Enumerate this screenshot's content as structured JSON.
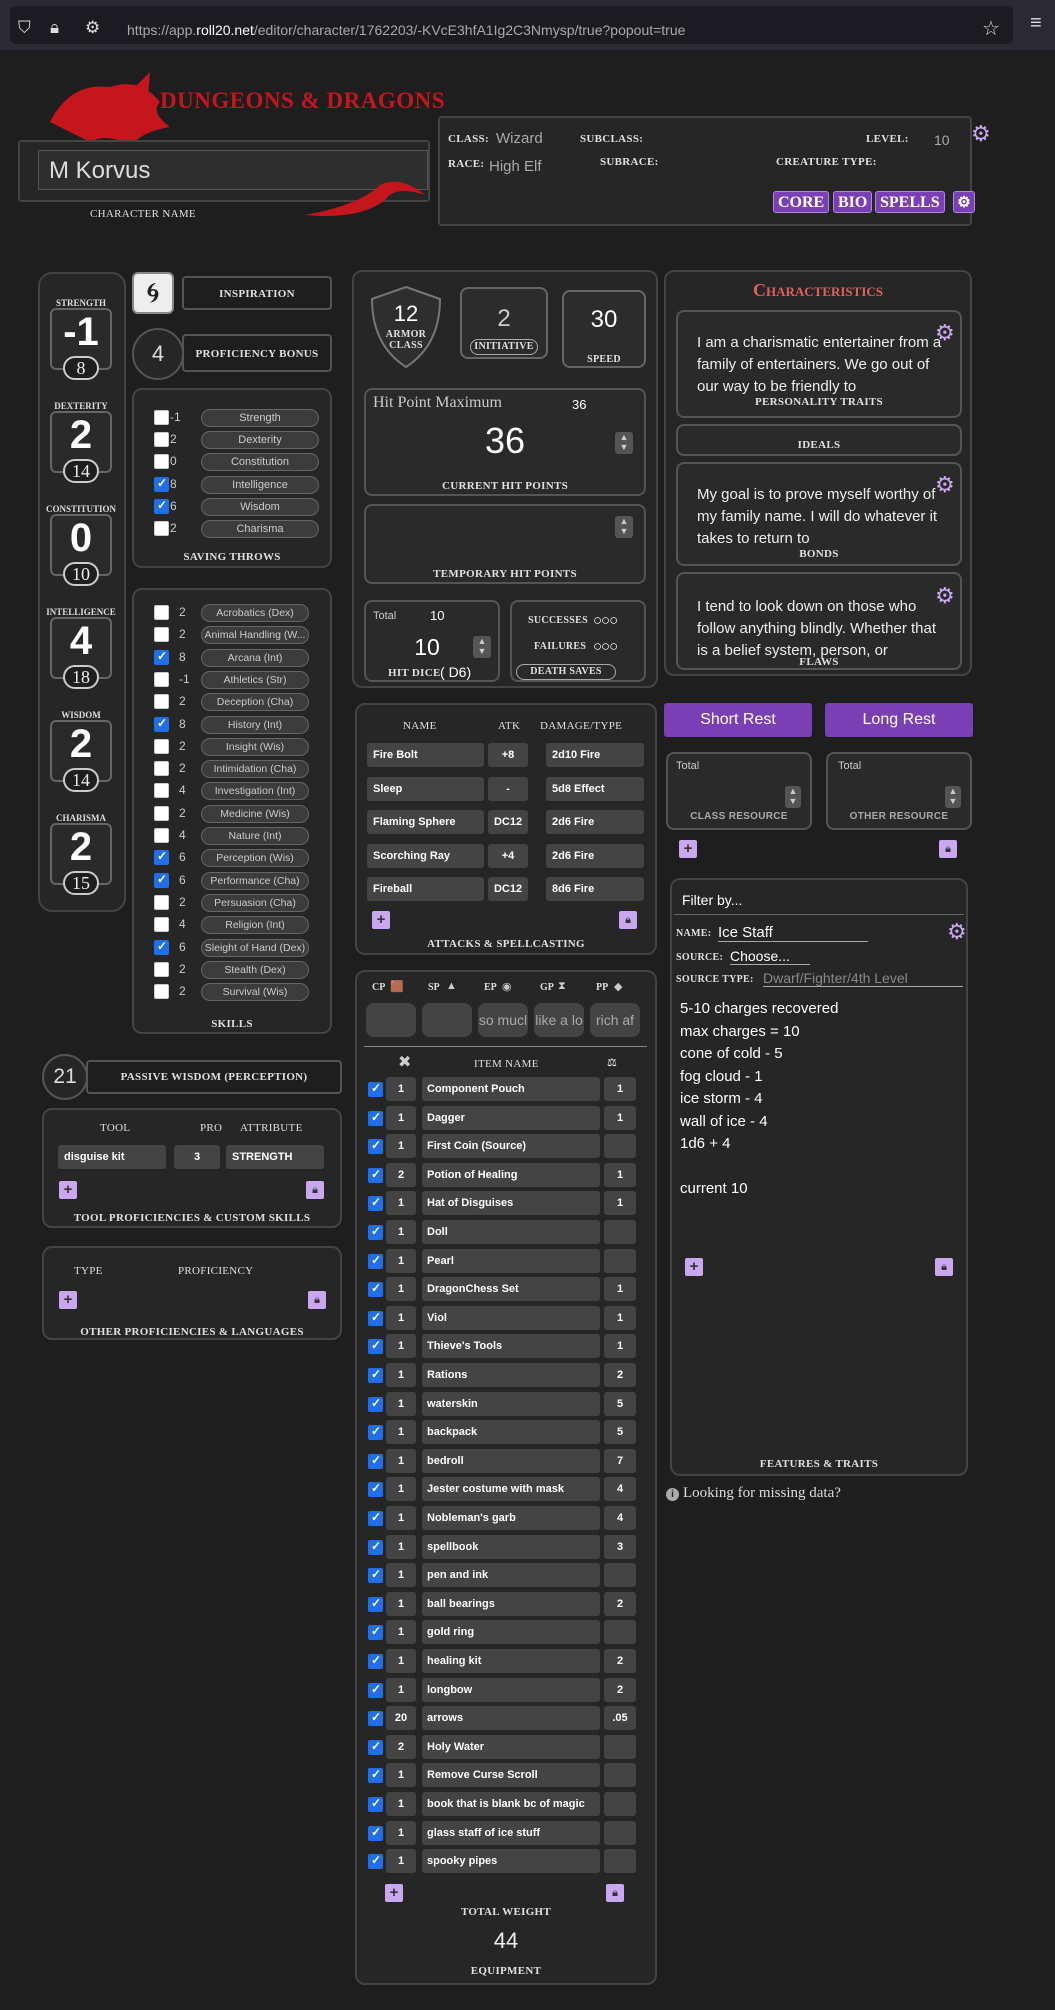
{
  "browser": {
    "url_prefix": "https://app.",
    "url_domain": "roll20.net",
    "url_path": "/editor/character/1762203/-KVcE3hfA1Ig2C3Nmysp/true?popout=true"
  },
  "header": {
    "logo_text": "DUNGEONS & DRAGONS",
    "character_name": "M Korvus",
    "character_name_label": "CHARACTER NAME",
    "class_label": "CLASS:",
    "class_value": "Wizard",
    "subclass_label": "SUBCLASS:",
    "level_label": "LEVEL:",
    "level_value": "10",
    "race_label": "RACE:",
    "race_value": "High Elf",
    "subrace_label": "SUBRACE:",
    "creature_type_label": "CREATURE TYPE:"
  },
  "tabs": [
    "CORE",
    "BIO",
    "SPELLS"
  ],
  "abilities": [
    {
      "name": "STRENGTH",
      "mod": "-1",
      "score": "8"
    },
    {
      "name": "DEXTERITY",
      "mod": "2",
      "score": "14"
    },
    {
      "name": "CONSTITUTION",
      "mod": "0",
      "score": "10"
    },
    {
      "name": "INTELLIGENCE",
      "mod": "4",
      "score": "18"
    },
    {
      "name": "WISDOM",
      "mod": "2",
      "score": "14"
    },
    {
      "name": "CHARISMA",
      "mod": "2",
      "score": "15"
    }
  ],
  "inspiration_label": "INSPIRATION",
  "proficiency": {
    "value": "4",
    "label": "PROFICIENCY BONUS"
  },
  "saving_throws": {
    "label": "SAVING THROWS",
    "items": [
      {
        "checked": false,
        "value": "-1",
        "name": "Strength"
      },
      {
        "checked": false,
        "value": "2",
        "name": "Dexterity"
      },
      {
        "checked": false,
        "value": "0",
        "name": "Constitution"
      },
      {
        "checked": true,
        "value": "8",
        "name": "Intelligence"
      },
      {
        "checked": true,
        "value": "6",
        "name": "Wisdom"
      },
      {
        "checked": false,
        "value": "2",
        "name": "Charisma"
      }
    ]
  },
  "skills": {
    "label": "SKILLS",
    "items": [
      {
        "checked": false,
        "value": "2",
        "name": "Acrobatics (Dex)"
      },
      {
        "checked": false,
        "value": "2",
        "name": "Animal Handling (W..."
      },
      {
        "checked": true,
        "value": "8",
        "name": "Arcana (Int)"
      },
      {
        "checked": false,
        "value": "-1",
        "name": "Athletics (Str)"
      },
      {
        "checked": false,
        "value": "2",
        "name": "Deception (Cha)"
      },
      {
        "checked": true,
        "value": "8",
        "name": "History (Int)"
      },
      {
        "checked": false,
        "value": "2",
        "name": "Insight (Wis)"
      },
      {
        "checked": false,
        "value": "2",
        "name": "Intimidation (Cha)"
      },
      {
        "checked": false,
        "value": "4",
        "name": "Investigation (Int)"
      },
      {
        "checked": false,
        "value": "2",
        "name": "Medicine (Wis)"
      },
      {
        "checked": false,
        "value": "4",
        "name": "Nature (Int)"
      },
      {
        "checked": true,
        "value": "6",
        "name": "Perception (Wis)"
      },
      {
        "checked": true,
        "value": "6",
        "name": "Performance (Cha)"
      },
      {
        "checked": false,
        "value": "2",
        "name": "Persuasion (Cha)"
      },
      {
        "checked": false,
        "value": "4",
        "name": "Religion (Int)"
      },
      {
        "checked": true,
        "value": "6",
        "name": "Sleight of Hand (Dex)"
      },
      {
        "checked": false,
        "value": "2",
        "name": "Stealth (Dex)"
      },
      {
        "checked": false,
        "value": "2",
        "name": "Survival (Wis)"
      }
    ]
  },
  "passive": {
    "value": "21",
    "label": "PASSIVE WISDOM (PERCEPTION)"
  },
  "tools": {
    "headers": [
      "TOOL",
      "PRO",
      "ATTRIBUTE"
    ],
    "row": {
      "tool": "disguise kit",
      "pro": "3",
      "attribute": "STRENGTH"
    },
    "label": "TOOL PROFICIENCIES & CUSTOM SKILLS"
  },
  "other_prof": {
    "headers": [
      "TYPE",
      "PROFICIENCY"
    ],
    "label": "OTHER PROFICIENCIES & LANGUAGES"
  },
  "combat": {
    "ac": "12",
    "ac_label": "ARMOR CLASS",
    "initiative": "2",
    "initiative_label": "INITIATIVE",
    "speed": "30",
    "speed_label": "SPEED",
    "hp_max_label": "Hit Point Maximum",
    "hp_max": "36",
    "hp_current": "36",
    "hp_current_label": "CURRENT HIT POINTS",
    "temp_label": "TEMPORARY HIT POINTS",
    "hd_total_label": "Total",
    "hd_total": "10",
    "hd_value": "10",
    "hd_label": "HIT DICE",
    "hd_die": "D6",
    "successes_label": "SUCCESSES",
    "failures_label": "FAILURES",
    "death_label": "DEATH SAVES"
  },
  "attacks": {
    "headers": [
      "NAME",
      "ATK",
      "DAMAGE/TYPE"
    ],
    "rows": [
      {
        "name": "Fire Bolt",
        "atk": "+8",
        "dmg": "2d10 Fire"
      },
      {
        "name": "Sleep",
        "atk": "-",
        "dmg": "5d8 Effect"
      },
      {
        "name": "Flaming Sphere",
        "atk": "DC12",
        "dmg": "2d6 Fire"
      },
      {
        "name": "Scorching Ray",
        "atk": "+4",
        "dmg": "2d6 Fire"
      },
      {
        "name": "Fireball",
        "atk": "DC12",
        "dmg": "8d6 Fire"
      }
    ],
    "label": "ATTACKS & SPELLCASTING"
  },
  "currency": {
    "labels": [
      "CP",
      "SP",
      "EP",
      "GP",
      "PP"
    ],
    "values": [
      "",
      "",
      "so mucl",
      "like a lo",
      "rich af"
    ]
  },
  "inventory": {
    "header": "ITEM NAME",
    "items": [
      {
        "q": "1",
        "n": "Component Pouch",
        "w": "1"
      },
      {
        "q": "1",
        "n": "Dagger",
        "w": "1"
      },
      {
        "q": "1",
        "n": "First Coin (Source)",
        "w": ""
      },
      {
        "q": "2",
        "n": "Potion of Healing",
        "w": "1"
      },
      {
        "q": "1",
        "n": "Hat of Disguises",
        "w": "1"
      },
      {
        "q": "1",
        "n": "Doll",
        "w": ""
      },
      {
        "q": "1",
        "n": "Pearl",
        "w": ""
      },
      {
        "q": "1",
        "n": "DragonChess Set",
        "w": "1"
      },
      {
        "q": "1",
        "n": "Viol",
        "w": "1"
      },
      {
        "q": "1",
        "n": "Thieve's Tools",
        "w": "1"
      },
      {
        "q": "1",
        "n": "Rations",
        "w": "2"
      },
      {
        "q": "1",
        "n": "waterskin",
        "w": "5"
      },
      {
        "q": "1",
        "n": "backpack",
        "w": "5"
      },
      {
        "q": "1",
        "n": "bedroll",
        "w": "7"
      },
      {
        "q": "1",
        "n": "Jester costume with mask",
        "w": "4"
      },
      {
        "q": "1",
        "n": "Nobleman's garb",
        "w": "4"
      },
      {
        "q": "1",
        "n": "spellbook",
        "w": "3"
      },
      {
        "q": "1",
        "n": "pen and ink",
        "w": ""
      },
      {
        "q": "1",
        "n": "ball bearings",
        "w": "2"
      },
      {
        "q": "1",
        "n": "gold ring",
        "w": ""
      },
      {
        "q": "1",
        "n": "healing kit",
        "w": "2"
      },
      {
        "q": "1",
        "n": "longbow",
        "w": "2"
      },
      {
        "q": "20",
        "n": "arrows",
        "w": ".05"
      },
      {
        "q": "2",
        "n": "Holy Water",
        "w": ""
      },
      {
        "q": "1",
        "n": "Remove Curse Scroll",
        "w": ""
      },
      {
        "q": "1",
        "n": "book that is blank bc of magic",
        "w": ""
      },
      {
        "q": "1",
        "n": "glass staff of ice stuff",
        "w": ""
      },
      {
        "q": "1",
        "n": "spooky pipes",
        "w": ""
      }
    ],
    "total_weight_label": "TOTAL WEIGHT",
    "total_weight": "44",
    "label": "EQUIPMENT"
  },
  "characteristics": {
    "title": "Characteristics",
    "traits_text": "I am a charismatic entertainer from a family of entertainers. We go out of our way to be friendly to",
    "traits_label": "PERSONALITY TRAITS",
    "ideals_label": "IDEALS",
    "bonds_text": "My goal is to prove myself worthy of my family name. I will do whatever it takes to return to",
    "bonds_label": "BONDS",
    "flaws_text": "I tend to look down on those who follow anything blindly. Whether that is a belief system, person, or",
    "flaws_label": "FLAWS"
  },
  "rest": {
    "short": "Short Rest",
    "long": "Long Rest"
  },
  "resources": {
    "total_label": "Total",
    "class_label": "CLASS RESOURCE",
    "other_label": "OTHER RESOURCE"
  },
  "features": {
    "filter": "Filter by...",
    "name_label": "NAME:",
    "name_value": "Ice Staff",
    "source_label": "SOURCE:",
    "source_value": "Choose...",
    "source_type_label": "SOURCE TYPE:",
    "source_type_placeholder": "Dwarf/Fighter/4th Level",
    "text_lines": [
      "5-10 charges recovered",
      "max charges = 10",
      "cone of cold - 5",
      "fog cloud - 1",
      "ice storm - 4",
      "wall of ice - 4",
      "1d6 + 4",
      "",
      "current 10"
    ],
    "label": "FEATURES & TRAITS"
  },
  "missing_data": "Looking for missing data?",
  "colors": {
    "accent": "#7b3fb5",
    "lilac": "#c9a8f0",
    "brand_red": "#c4161c"
  }
}
